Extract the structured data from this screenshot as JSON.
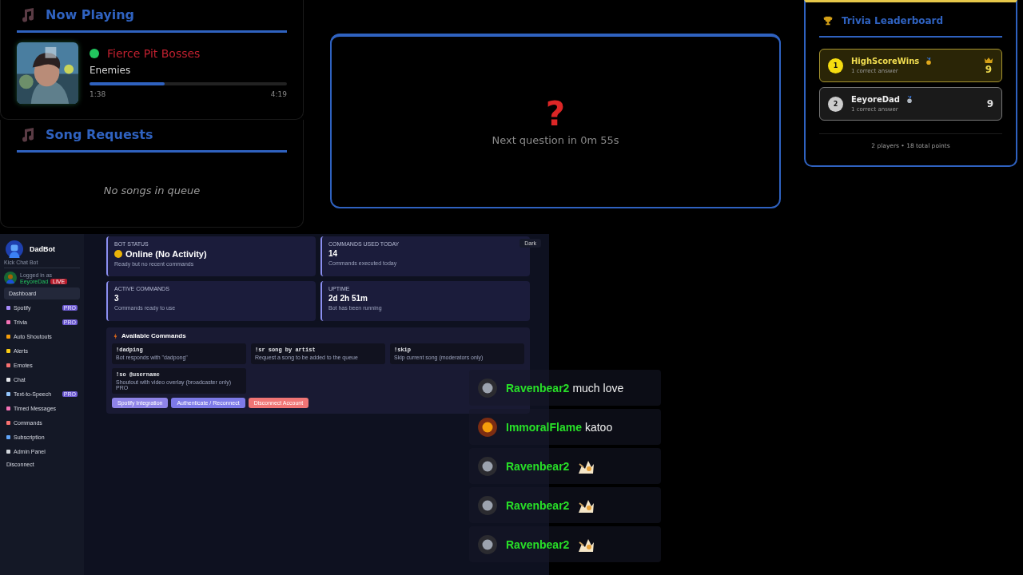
{
  "now_playing": {
    "title": "Now Playing",
    "artist": "Fierce Pit Bosses",
    "song": "Enemies",
    "level": 0.38,
    "elapsed": "1:38",
    "duration": "4:19"
  },
  "song_requests": {
    "title": "Song Requests",
    "empty_message": "No songs in queue"
  },
  "trivia_question": {
    "mark": "?",
    "countdown": "Next question in 0m 55s"
  },
  "leaderboard": {
    "title": "Trivia Leaderboard",
    "players": [
      {
        "rank": "1",
        "name": "HighScoreWins",
        "answers": "1 correct answer",
        "score": "9",
        "leader": true
      },
      {
        "rank": "2",
        "name": "EeyoreDad",
        "answers": "1 correct answer",
        "score": "9",
        "leader": false
      }
    ],
    "footer": "2 players • 18 total points"
  },
  "dashboard": {
    "sidebar": {
      "bot_name": "DadBot",
      "subtitle": "Kick Chat Bot",
      "logged_in_label": "Logged in as",
      "user": "EeyoreDad",
      "badge": "LIVE",
      "items": [
        {
          "label": "Dashboard",
          "selected": true
        },
        {
          "label": "Spotify",
          "selected": false,
          "badge": "PRO"
        },
        {
          "label": "Trivia",
          "selected": false,
          "badge": "PRO"
        },
        {
          "label": "Auto Shoutouts",
          "selected": false
        },
        {
          "label": "Alerts",
          "selected": false
        },
        {
          "label": "Emotes",
          "selected": false
        },
        {
          "label": "Chat",
          "selected": false
        },
        {
          "label": "Text-to-Speech",
          "selected": false,
          "badge": "PRO"
        },
        {
          "label": "Timed Messages",
          "selected": false
        },
        {
          "label": "Commands",
          "selected": false
        },
        {
          "label": "Subscription",
          "selected": false
        },
        {
          "label": "Admin Panel",
          "selected": false
        }
      ],
      "disconnect": "Disconnect"
    },
    "theme_toggle": "Dark",
    "stats": [
      {
        "label": "BOT STATUS",
        "value": "Online (No Activity)",
        "note": "Ready but no recent commands",
        "kind": "status"
      },
      {
        "label": "COMMANDS USED TODAY",
        "value": "14",
        "note": "Commands executed today",
        "kind": "plain"
      },
      {
        "label": "ACTIVE COMMANDS",
        "value": "3",
        "note": "Commands ready to use",
        "kind": "plain"
      },
      {
        "label": "UPTIME",
        "value": "2d 2h 51m",
        "note": "Bot has been running",
        "kind": "plain"
      }
    ],
    "commands_title": "Available Commands",
    "commands": [
      {
        "command": "!dadping",
        "description": "Bot responds with \"dadpong\""
      },
      {
        "command": "!sr song by artist",
        "description": "Request a song to be added to the queue"
      },
      {
        "command": "!skip",
        "description": "Skip current song (moderators only)"
      },
      {
        "command": "!so @username",
        "description": "Shoutout with video overlay (broadcaster only) PRO"
      }
    ],
    "buttons": [
      {
        "label": "Spotify Integration",
        "kind": "spotify"
      },
      {
        "label": "Authenticate / Reconnect",
        "kind": "auth"
      },
      {
        "label": "Disconnect Account",
        "kind": "danger"
      }
    ]
  },
  "chat": [
    {
      "user": "Ravenbear2",
      "message": "much love",
      "kind": "text"
    },
    {
      "user": "ImmoralFlame",
      "message": "katoo",
      "kind": "text"
    },
    {
      "user": "Ravenbear2",
      "kind": "emote"
    },
    {
      "user": "Ravenbear2",
      "kind": "emote"
    },
    {
      "user": "Ravenbear2",
      "kind": "emote"
    }
  ]
}
